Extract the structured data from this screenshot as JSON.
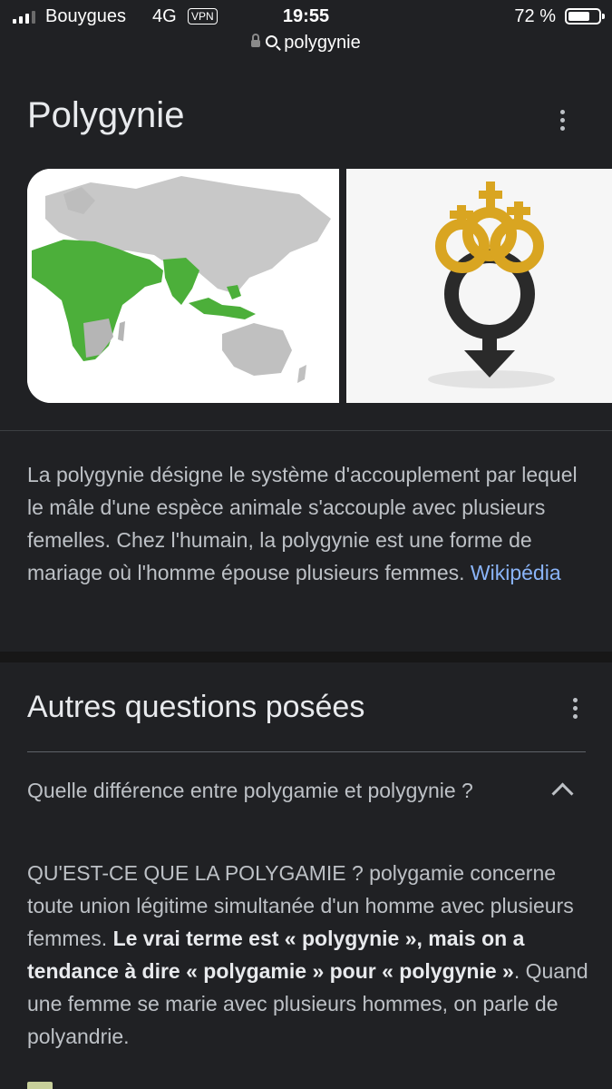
{
  "status_bar": {
    "carrier": "Bouygues",
    "network": "4G",
    "vpn": "VPN",
    "time": "19:55",
    "battery_percent": "72 %",
    "battery_level": 0.72
  },
  "url_bar": {
    "query": "polygynie"
  },
  "knowledge_panel": {
    "title": "Polygynie",
    "images": [
      {
        "icon": "world-map-image",
        "colors": {
          "highlight": "#4caf3a",
          "land": "#c9c9c9"
        }
      },
      {
        "icon": "gender-symbols-image",
        "colors": {
          "gold": "#d9a521",
          "dark": "#2a2a2a"
        }
      }
    ],
    "description": "La polygynie désigne le système d'accouplement par lequel le mâle d'une espèce animale s'accouple avec plusieurs femelles. Chez l'humain, la polygynie est une forme de mariage où l'homme épouse plusieurs femmes.",
    "source_link": "Wikipédia"
  },
  "people_also_ask": {
    "title": "Autres questions posées",
    "question": "Quelle différence entre polygamie et polygynie ?",
    "answer": {
      "part1": "QU'EST-CE QUE LA POLYGAMIE ? polygamie concerne toute union légitime simultanée d'un homme avec plusieurs femmes.",
      "bold": "Le vrai terme est « polygynie », mais on a tendance à dire « polygamie » pour « polygynie »",
      "part2": ". Quand une femme se marie avec plusieurs hommes, on parle de polyandrie."
    }
  },
  "colors": {
    "background": "#202124",
    "text_primary": "#e8eaed",
    "text_secondary": "#bdc1c6",
    "link": "#8ab4f8"
  }
}
